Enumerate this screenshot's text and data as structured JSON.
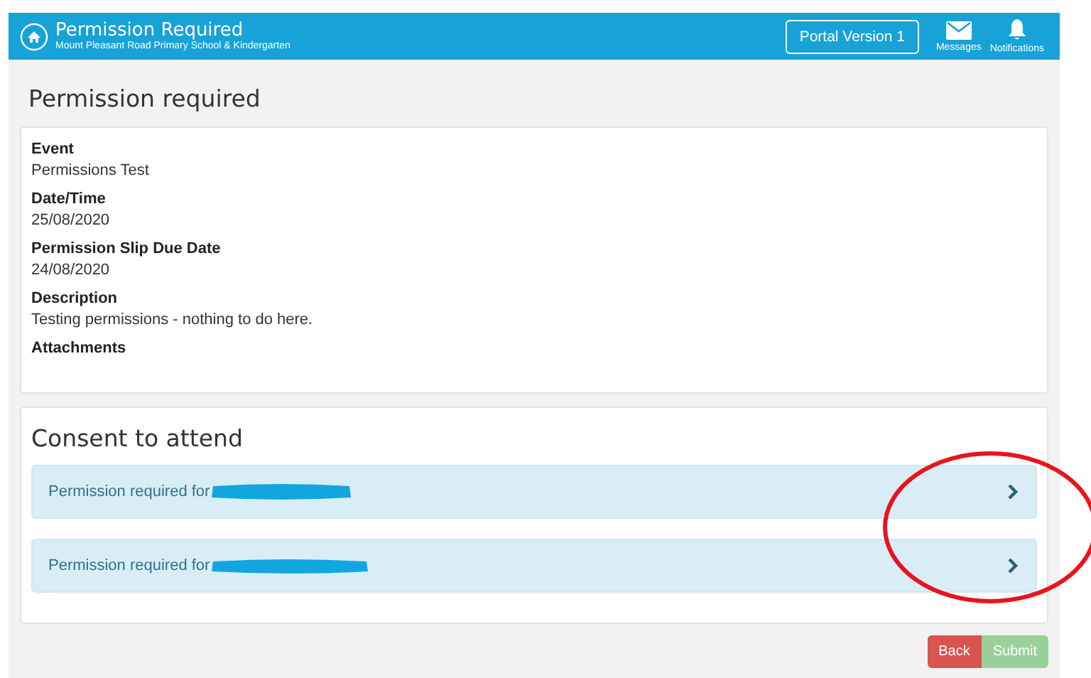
{
  "header": {
    "title": "Permission Required",
    "subtitle": "Mount Pleasant Road Primary School & Kindergarten",
    "portal_button": "Portal Version 1",
    "icons": [
      {
        "kind": "mail",
        "label": "Messages"
      },
      {
        "kind": "bell",
        "label": "Notifications"
      }
    ]
  },
  "page_title": "Permission required",
  "details": [
    {
      "label": "Event",
      "value": "Permissions Test"
    },
    {
      "label": "Date/Time",
      "value": "25/08/2020"
    },
    {
      "label": "Permission Slip Due Date",
      "value": "24/08/2020"
    },
    {
      "label": "Description",
      "value": "Testing permissions - nothing to do here."
    },
    {
      "label": "Attachments"
    }
  ],
  "consent": {
    "title": "Consent to attend",
    "items": [
      {
        "label": "Permission required for"
      },
      {
        "label": "Permission required for"
      }
    ]
  },
  "buttons": [
    {
      "label": "Back",
      "kind": "danger",
      "disabled": false
    },
    {
      "label": "Submit",
      "kind": "success",
      "disabled": true
    }
  ]
}
